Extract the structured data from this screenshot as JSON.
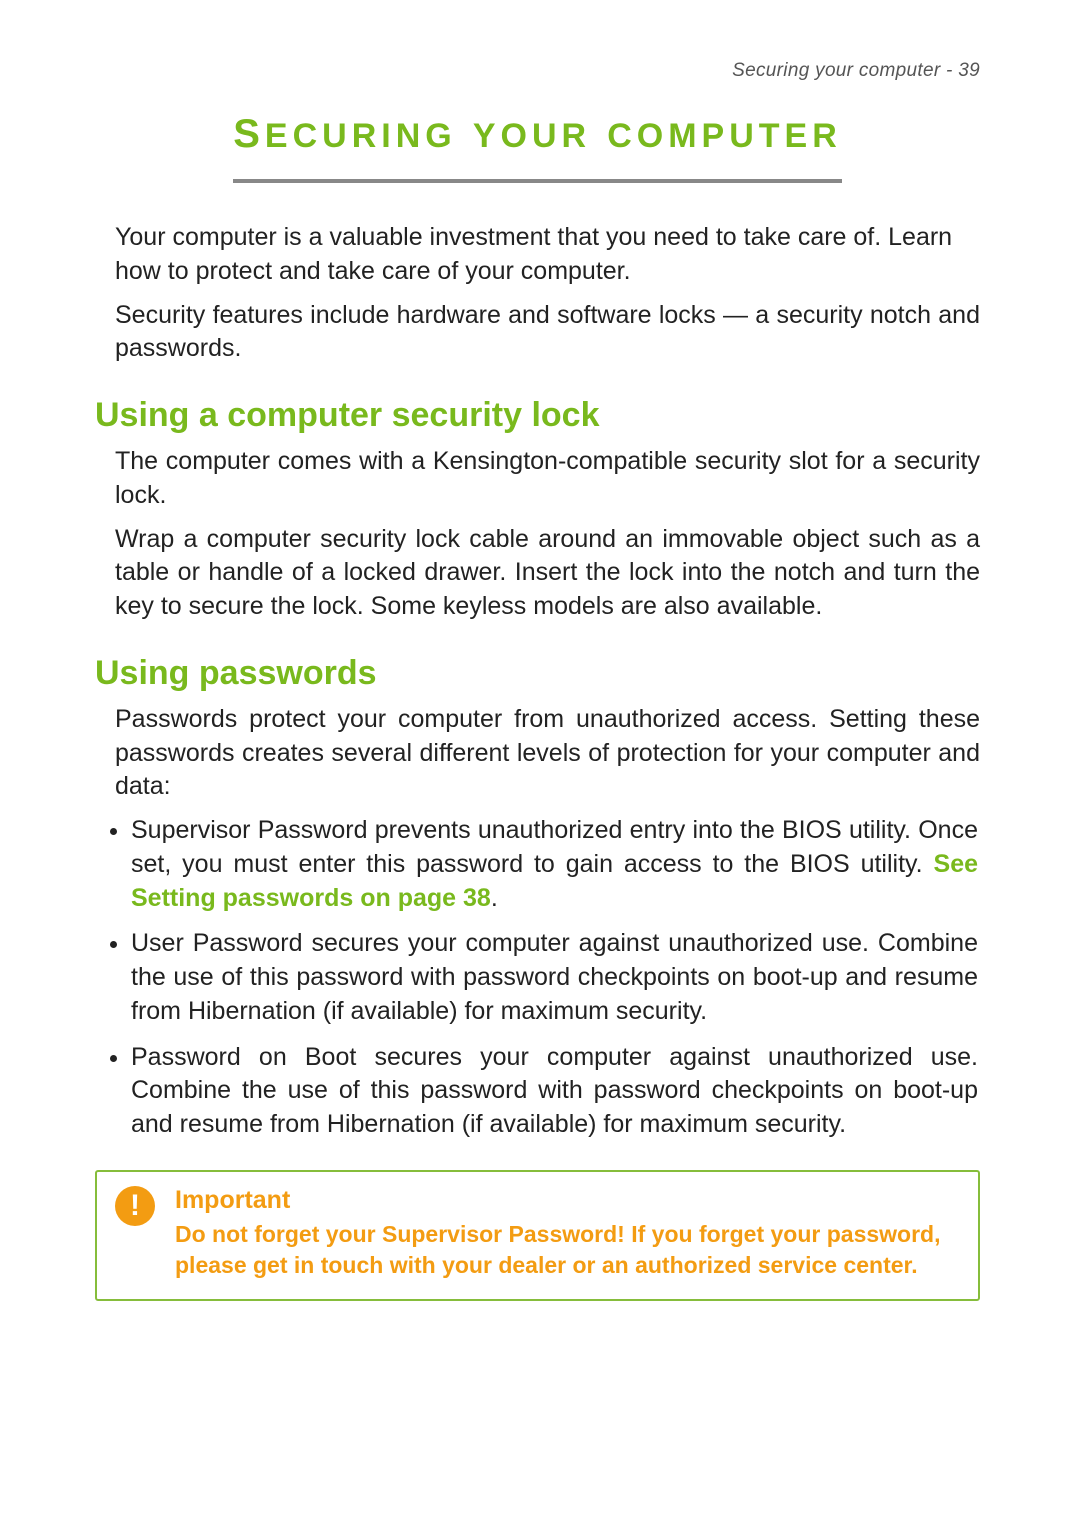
{
  "header": {
    "running_title": "Securing your computer - 39"
  },
  "title": "SECURING YOUR COMPUTER",
  "intro": {
    "p1": "Your computer is a valuable investment that you need to take care of. Learn how to protect and take care of your computer.",
    "p2": "Security features include hardware and software locks — a security notch and passwords."
  },
  "sections": {
    "lock": {
      "heading": "Using a computer security lock",
      "p1": "The computer comes with a Kensington-compatible security slot for a security lock.",
      "p2": "Wrap a computer security lock cable around an immovable object such as a table or handle of a locked drawer. Insert the lock into the notch and turn the key to secure the lock. Some keyless models are also available."
    },
    "passwords": {
      "heading": "Using passwords",
      "p1": "Passwords protect your computer from unauthorized access. Setting these passwords creates several different levels of protection for your computer and data:",
      "items": [
        {
          "pre": "Supervisor Password prevents unauthorized entry into the BIOS utility. Once set, you must enter this password to gain access to the BIOS utility. ",
          "link": "See Setting passwords on page 38",
          "post": "."
        },
        {
          "pre": "User Password secures your computer against unauthorized use. Combine the use of this password with password checkpoints on boot-up and resume from Hibernation (if available) for maximum security.",
          "link": "",
          "post": ""
        },
        {
          "pre": "Password on Boot secures your computer against unauthorized use. Combine the use of this password with password checkpoints on boot-up and resume from Hibernation (if available) for maximum security.",
          "link": "",
          "post": ""
        }
      ]
    }
  },
  "callout": {
    "icon_glyph": "!",
    "title": "Important",
    "body": "Do not forget your Supervisor Password! If you forget your password, please get in touch with your dealer or an authorized service center."
  }
}
